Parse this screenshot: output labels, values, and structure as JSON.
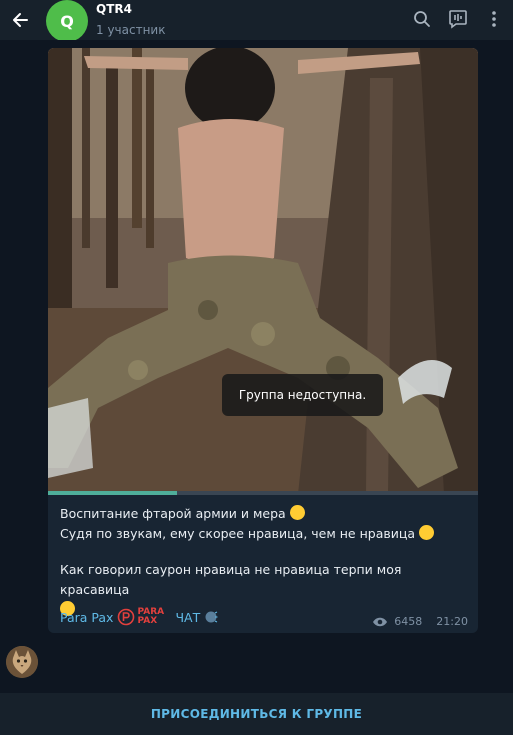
{
  "header": {
    "avatar_letter": "Q",
    "title": "QTR4",
    "subtitle": "1 участник"
  },
  "message": {
    "toast": "Группа недоступна.",
    "line1": "Воспитание фтарой армии и мера",
    "line2": "Судя по звукам, ему скорее нравица, чем не нравица",
    "line3": "Как говорил саурон нравица не нравица терпи моя красавица",
    "signature_name": "Para Pax",
    "signature_logo": "PARA PAX",
    "signature_chat": "ЧАТ",
    "views": "6458",
    "time": "21:20",
    "video_progress": 0.3
  },
  "join_button": "ПРИСОЕДИНИТЬСЯ К ГРУППЕ",
  "colors": {
    "header_bg": "#17212b",
    "chat_bg": "#0e1621",
    "bubble_bg": "#182533",
    "accent": "#5fb9e6",
    "avatar_green": "#4fbd4a",
    "progress": "#4fae9a"
  }
}
